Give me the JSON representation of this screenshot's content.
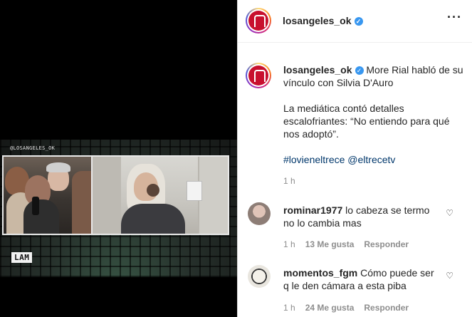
{
  "media": {
    "handle": "@LOSANGELES_OK",
    "logo": "LAM"
  },
  "header": {
    "username": "losangeles_ok",
    "more_icon": "more-dots-icon"
  },
  "caption": {
    "username": "losangeles_ok",
    "line1": "More Rial habló de su vínculo con Silvia D'Auro",
    "line2": "La mediática contó detalles escalofriantes: “No entiendo para qué nos adoptó”.",
    "hashtag": "#lovieneltrece",
    "mention": "@eltrecetv",
    "time": "1 h"
  },
  "comments": [
    {
      "username": "rominar1977",
      "text": "lo cabeza se termo no lo cambia mas",
      "time": "1 h",
      "likes": "13 Me gusta",
      "reply": "Responder"
    },
    {
      "username": "momentos_fgm",
      "text": "Cómo puede ser q le den cámara a esta piba",
      "time": "1 h",
      "likes": "24 Me gusta",
      "reply": "Responder"
    }
  ],
  "colors": {
    "verified": "#3897f0",
    "link": "#00376b",
    "muted": "#8e8e8e",
    "brand_red": "#c8102e"
  }
}
